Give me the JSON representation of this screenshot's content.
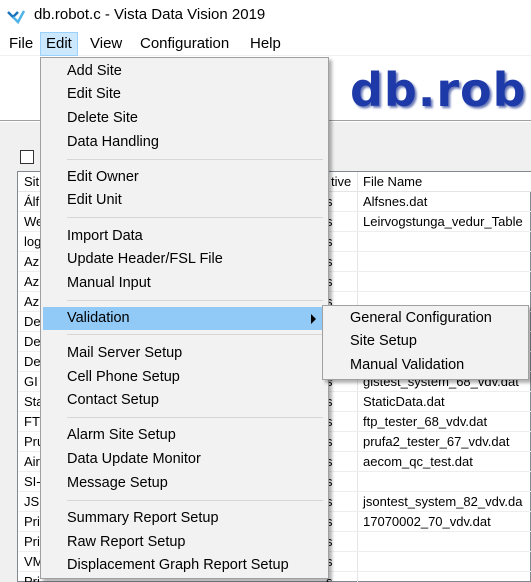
{
  "window": {
    "title": "db.robot.c - Vista Data Vision 2019"
  },
  "menubar": {
    "file": "File",
    "edit": "Edit",
    "view": "View",
    "configuration": "Configuration",
    "help": "Help"
  },
  "banner": {
    "logo_text": "db.rob"
  },
  "grid": {
    "headers": {
      "site": "Sit",
      "active": "tive",
      "file_name": "File Name"
    },
    "rows": [
      {
        "site": "Álf",
        "active": "s",
        "file": "Alfsnes.dat"
      },
      {
        "site": "We",
        "active": "s",
        "file": "Leirvogstunga_vedur_Table"
      },
      {
        "site": "log",
        "active": "s",
        "file": ""
      },
      {
        "site": "Az",
        "active": "s",
        "file": ""
      },
      {
        "site": "Az",
        "active": "s",
        "file": ""
      },
      {
        "site": "Az",
        "active": "s",
        "file": ""
      },
      {
        "site": "De",
        "active": "s",
        "file": ""
      },
      {
        "site": "De",
        "active": "s",
        "file": ""
      },
      {
        "site": "De",
        "active": "s",
        "file": ""
      },
      {
        "site": "GI",
        "active": "s",
        "file": "gistest_system_68_vdv.dat"
      },
      {
        "site": "Sta",
        "active": "s",
        "file": "StaticData.dat"
      },
      {
        "site": "FT",
        "active": "s",
        "file": "ftp_tester_68_vdv.dat"
      },
      {
        "site": "Pru",
        "active": "s",
        "file": "prufa2_tester_67_vdv.dat"
      },
      {
        "site": "Air",
        "active": "s",
        "file": "aecom_qc_test.dat"
      },
      {
        "site": "SI-",
        "active": "s",
        "file": ""
      },
      {
        "site": "JS",
        "active": "s",
        "file": "jsontest_system_82_vdv.da"
      },
      {
        "site": "Pri",
        "active": "s",
        "file": "17070002_70_vdv.dat"
      },
      {
        "site": "Pri",
        "active": "s",
        "file": ""
      },
      {
        "site": "VM",
        "active": "s",
        "file": ""
      },
      {
        "site": "Pri",
        "active": "s",
        "file": ""
      }
    ]
  },
  "edit_menu": {
    "add_site": "Add Site",
    "edit_site": "Edit Site",
    "delete_site": "Delete Site",
    "data_handling": "Data Handling",
    "edit_owner": "Edit Owner",
    "edit_unit": "Edit Unit",
    "import_data": "Import Data",
    "update_header": "Update Header/FSL File",
    "manual_input": "Manual Input",
    "validation": "Validation",
    "mail_server_setup": "Mail Server Setup",
    "cell_phone_setup": "Cell Phone Setup",
    "contact_setup": "Contact Setup",
    "alarm_site_setup": "Alarm Site Setup",
    "data_update_monitor": "Data Update Monitor",
    "message_setup": "Message Setup",
    "summary_report_setup": "Summary Report Setup",
    "raw_report_setup": "Raw Report Setup",
    "displacement_graph_report_setup": "Displacement Graph Report Setup"
  },
  "validation_menu": {
    "general_configuration": "General Configuration",
    "site_setup": "Site Setup",
    "manual_validation": "Manual Validation"
  },
  "colors": {
    "menu_highlight": "#91c9f7",
    "logo": "#1e3aa8",
    "active_menubar": "#cce8ff"
  }
}
